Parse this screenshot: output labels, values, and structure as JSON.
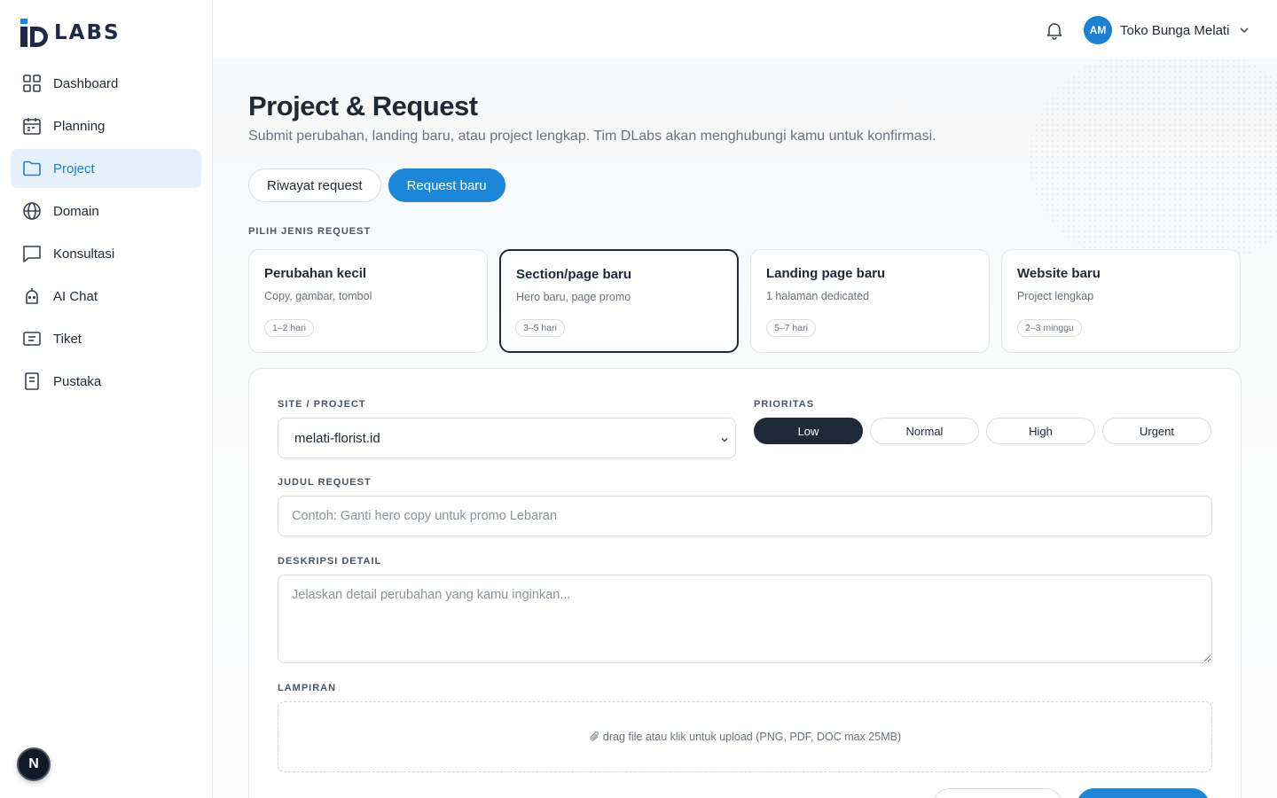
{
  "brand": {
    "logo_text": "LABS"
  },
  "sidebar": {
    "items": [
      {
        "label": "Dashboard",
        "icon": "grid-icon",
        "active": false
      },
      {
        "label": "Planning",
        "icon": "calendar-icon",
        "active": false
      },
      {
        "label": "Project",
        "icon": "folder-icon",
        "active": true
      },
      {
        "label": "Domain",
        "icon": "globe-icon",
        "active": false
      },
      {
        "label": "Konsultasi",
        "icon": "chat-bubble-icon",
        "active": false
      },
      {
        "label": "AI Chat",
        "icon": "robot-icon",
        "active": false
      },
      {
        "label": "Tiket",
        "icon": "ticket-icon",
        "active": false
      },
      {
        "label": "Pustaka",
        "icon": "book-icon",
        "active": false
      }
    ],
    "next_badge": "N"
  },
  "topbar": {
    "avatar_initials": "AM",
    "user_name": "Toko Bunga Melati"
  },
  "page": {
    "title": "Project & Request",
    "subtitle": "Submit perubahan, landing baru, atau project lengkap. Tim DLabs akan menghubungi kamu untuk konfirmasi.",
    "tabs": [
      {
        "label": "Riwayat request",
        "active": false
      },
      {
        "label": "Request baru",
        "active": true
      }
    ]
  },
  "request_types": {
    "label": "PILIH JENIS REQUEST",
    "items": [
      {
        "title": "Perubahan kecil",
        "desc": "Copy, gambar, tombol",
        "duration": "1–2 hari",
        "selected": false
      },
      {
        "title": "Section/page baru",
        "desc": "Hero baru, page promo",
        "duration": "3–5 hari",
        "selected": true
      },
      {
        "title": "Landing page baru",
        "desc": "1 halaman dedicated",
        "duration": "5–7 hari",
        "selected": false
      },
      {
        "title": "Website baru",
        "desc": "Project lengkap",
        "duration": "2–3 minggu",
        "selected": false
      }
    ]
  },
  "form": {
    "site_label": "SITE / PROJECT",
    "site_value": "melati-florist.id",
    "priority_label": "PRIORITAS",
    "priorities": [
      {
        "label": "Low",
        "active": true
      },
      {
        "label": "Normal",
        "active": false
      },
      {
        "label": "High",
        "active": false
      },
      {
        "label": "Urgent",
        "active": false
      }
    ],
    "title_label": "JUDUL REQUEST",
    "title_placeholder": "Contoh: Ganti hero copy untuk promo Lebaran",
    "desc_label": "DESKRIPSI DETAIL",
    "desc_placeholder": "Jelaskan detail perubahan yang kamu inginkan...",
    "attach_label": "LAMPIRAN",
    "attach_hint": "drag file atau klik untuk upload (PNG, PDF, DOC max 25MB)"
  },
  "colors": {
    "accent": "#1c87d6",
    "dark": "#1f2937",
    "active_nav_bg": "#e6f1fb"
  }
}
